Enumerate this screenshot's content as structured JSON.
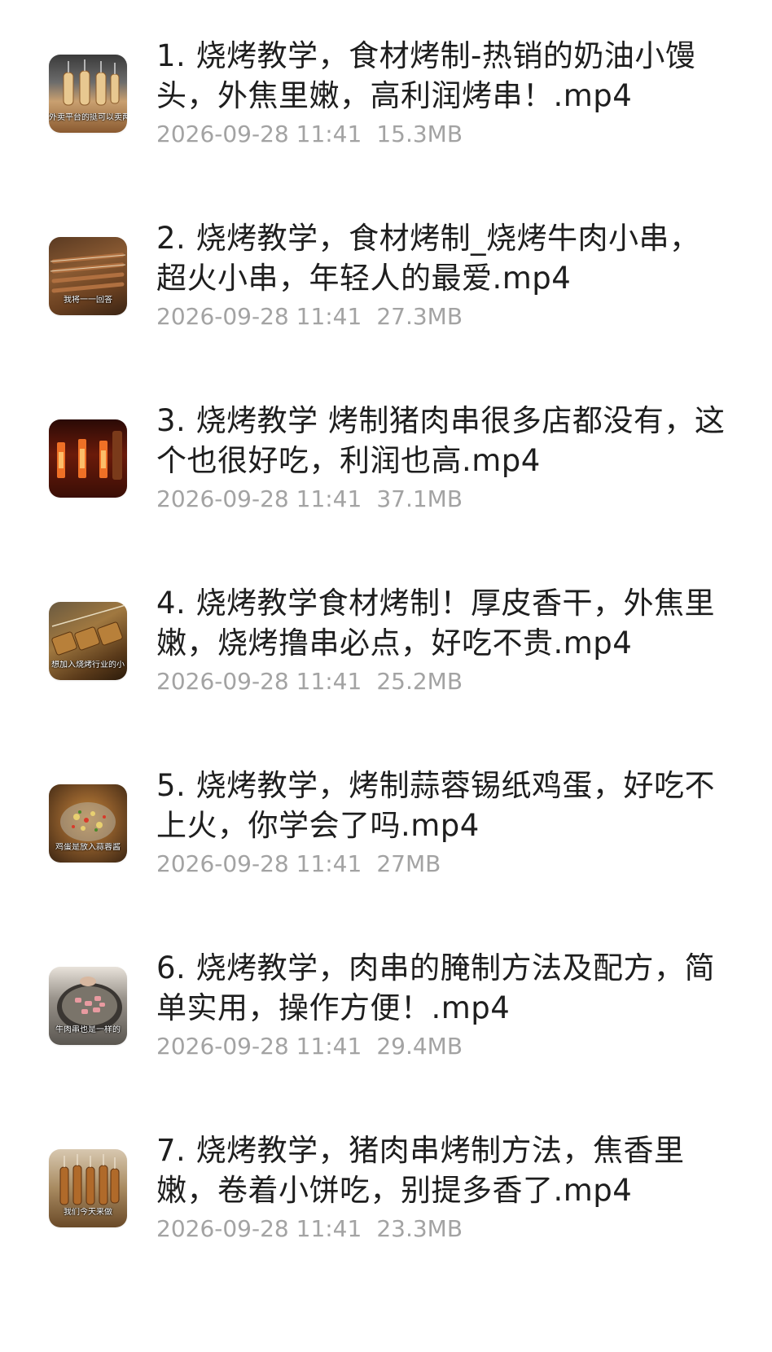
{
  "files": [
    {
      "title": "1. 烧烤教学，食材烤制-热销的奶油小馒头，外焦里嫩，高利润烤串！.mp4",
      "date": "2026-09-28 11:41",
      "size": "15.3MB",
      "thumb_caption": "外卖平台的挺可以卖两"
    },
    {
      "title": "2. 烧烤教学，食材烤制_烧烤牛肉小串，超火小串，年轻人的最爱.mp4",
      "date": "2026-09-28 11:41",
      "size": "27.3MB",
      "thumb_caption": "我将一一回答"
    },
    {
      "title": "3. 烧烤教学 烤制猪肉串很多店都没有，这个也很好吃，利润也高.mp4",
      "date": "2026-09-28 11:41",
      "size": "37.1MB",
      "thumb_caption": ""
    },
    {
      "title": "4. 烧烤教学食材烤制！厚皮香干，外焦里嫩，烧烤撸串必点，好吃不贵.mp4",
      "date": "2026-09-28 11:41",
      "size": "25.2MB",
      "thumb_caption": "想加入烧烤行业的小"
    },
    {
      "title": "5. 烧烤教学，烤制蒜蓉锡纸鸡蛋，好吃不上火，你学会了吗.mp4",
      "date": "2026-09-28 11:41",
      "size": "27MB",
      "thumb_caption": "鸡蛋是放入蒜蓉酱"
    },
    {
      "title": "6. 烧烤教学，肉串的腌制方法及配方，简单实用，操作方便！.mp4",
      "date": "2026-09-28 11:41",
      "size": "29.4MB",
      "thumb_caption": "牛肉串也是一样的"
    },
    {
      "title": "7. 烧烤教学，猪肉串烤制方法，焦香里嫩，卷着小饼吃，别提多香了.mp4",
      "date": "2026-09-28 11:41",
      "size": "23.3MB",
      "thumb_caption": "我们今天来做"
    }
  ],
  "colors": {
    "title": "#1e1e1e",
    "meta": "#a3a3a3",
    "background": "#ffffff"
  }
}
